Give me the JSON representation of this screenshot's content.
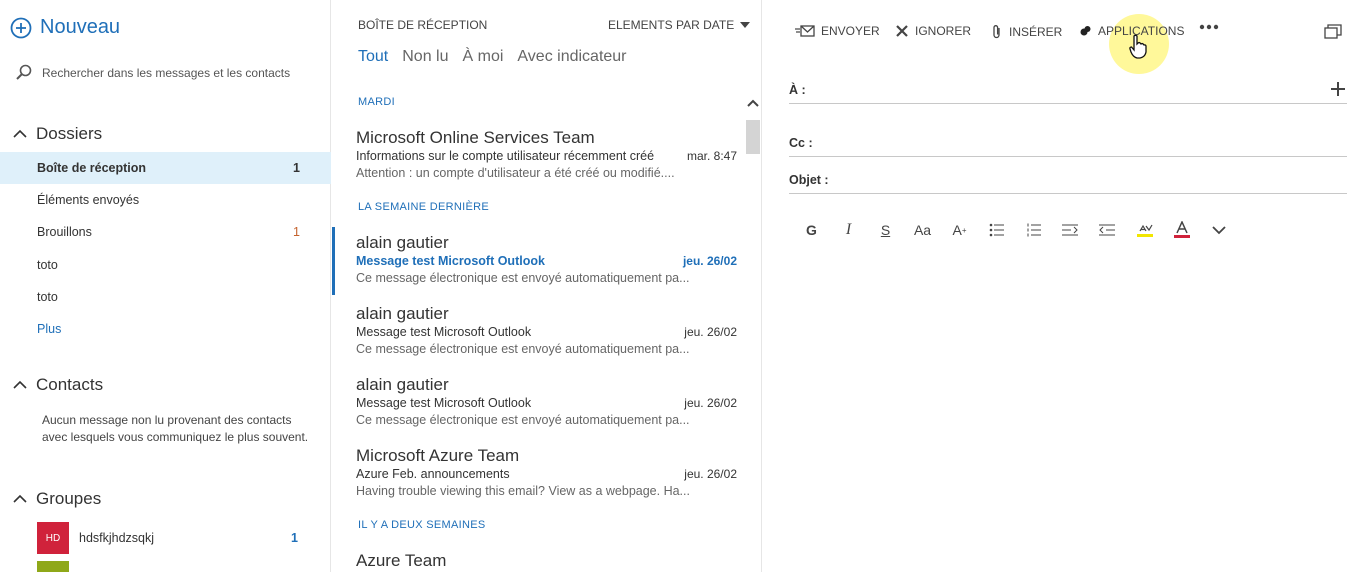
{
  "left_pane": {
    "new_label": "Nouveau",
    "search_placeholder": "Rechercher dans les messages et les contacts",
    "folders_header": "Dossiers",
    "folders": [
      {
        "label": "Boîte de réception",
        "count": "1"
      },
      {
        "label": "Éléments envoyés",
        "count": ""
      },
      {
        "label": "Brouillons",
        "count": "1"
      },
      {
        "label": "toto",
        "count": ""
      },
      {
        "label": "toto",
        "count": ""
      },
      {
        "label": "Plus",
        "count": ""
      }
    ],
    "contacts_header": "Contacts",
    "contacts_message": "Aucun message non lu provenant des contacts avec lesquels vous communiquez le plus souvent.",
    "groups_header": "Groupes",
    "groups": [
      {
        "initials": "HD",
        "name": "hdsfkjhdzsqkj",
        "count": "1",
        "color": "#d0223b"
      },
      {
        "initials": "",
        "name": "",
        "count": "",
        "color": "#8fa819"
      }
    ]
  },
  "middle_pane": {
    "title": "BOÎTE DE RÉCEPTION",
    "sort_label": "ELEMENTS PAR DATE",
    "filters": [
      "Tout",
      "Non lu",
      "À moi",
      "Avec indicateur"
    ],
    "group_headers": [
      "MARDI",
      "LA SEMAINE DERNIÈRE",
      "IL Y A DEUX SEMAINES"
    ],
    "messages": [
      {
        "sender": "Microsoft Online Services Team",
        "subject": "Informations sur le compte utilisateur récemment créé",
        "date": "mar. 8:47",
        "preview": "Attention : un compte d'utilisateur a été créé ou modifié...."
      },
      {
        "sender": "alain gautier",
        "subject": "Message test Microsoft Outlook",
        "date": "jeu. 26/02",
        "preview": "Ce message électronique est envoyé automatiquement pa..."
      },
      {
        "sender": "alain gautier",
        "subject": "Message test Microsoft Outlook",
        "date": "jeu. 26/02",
        "preview": "Ce message électronique est envoyé automatiquement pa..."
      },
      {
        "sender": "alain gautier",
        "subject": "Message test Microsoft Outlook",
        "date": "jeu. 26/02",
        "preview": "Ce message électronique est envoyé automatiquement pa..."
      },
      {
        "sender": "Microsoft Azure Team",
        "subject": "Azure Feb. announcements",
        "date": "jeu. 26/02",
        "preview": "Having trouble viewing this email? View as a webpage. Ha..."
      },
      {
        "sender": "Azure Team",
        "subject": "",
        "date": "",
        "preview": ""
      }
    ]
  },
  "compose_pane": {
    "toolbar": {
      "send": "ENVOYER",
      "discard": "IGNORER",
      "insert": "INSÉRER",
      "apps": "APPLICATIONS"
    },
    "to_label": "À :",
    "cc_label": "Cc :",
    "subject_label": "Objet :",
    "format": {
      "bold": "G",
      "italic": "I",
      "strike": "S",
      "font_size": "Aa",
      "grow_font": "A"
    }
  },
  "colors": {
    "accent": "#1f6fb8",
    "selected_bg": "#dff0fa",
    "highlight": "#f2e600",
    "font_color_bar": "#d0223b"
  }
}
